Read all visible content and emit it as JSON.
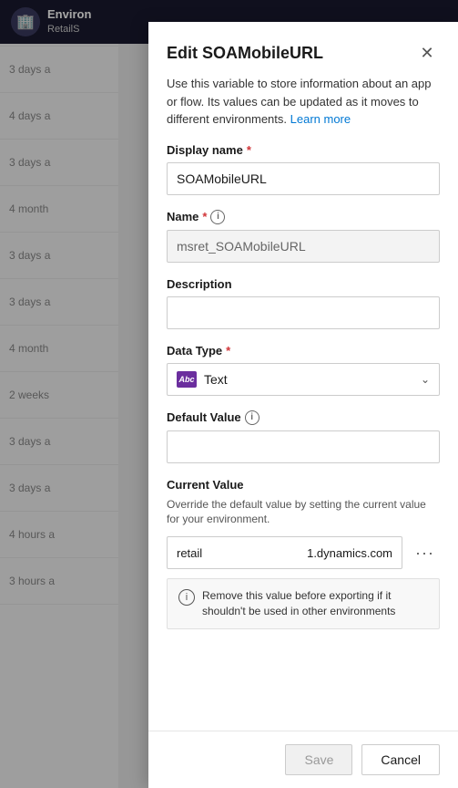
{
  "header": {
    "icon": "🏢",
    "title": "Environ",
    "subtitle": "RetailS"
  },
  "background_items": [
    {
      "time": "3 days a"
    },
    {
      "time": "3 days a"
    },
    {
      "time": "4 days a"
    },
    {
      "time": "3 days a"
    },
    {
      "time": "4 month"
    },
    {
      "time": "3 days a"
    },
    {
      "time": "3 days a"
    },
    {
      "time": "4 month"
    },
    {
      "time": "2 weeks"
    },
    {
      "time": "3 days a"
    },
    {
      "time": "3 days a"
    },
    {
      "time": "4 hours a"
    },
    {
      "time": "3 hours a"
    }
  ],
  "dialog": {
    "title": "Edit SOAMobileURL",
    "description": "Use this variable to store information about an app or flow. Its values can be updated as it moves to different environments.",
    "learn_more_label": "Learn more",
    "fields": {
      "display_name": {
        "label": "Display name",
        "required": true,
        "value": "SOAMobileURL",
        "placeholder": ""
      },
      "name": {
        "label": "Name",
        "required": true,
        "info": true,
        "value": "msret_SOAMobileURL",
        "readonly": true
      },
      "description": {
        "label": "Description",
        "required": false,
        "value": "",
        "placeholder": ""
      },
      "data_type": {
        "label": "Data Type",
        "required": true,
        "type_icon_label": "Abc",
        "selected_value": "Text"
      },
      "default_value": {
        "label": "Default Value",
        "info": true,
        "value": "",
        "placeholder": ""
      },
      "current_value": {
        "label": "Current Value",
        "description": "Override the default value by setting the current value for your environment.",
        "left_text": "retail",
        "right_text": "1.dynamics.com"
      }
    },
    "notice_text": "Remove this value before exporting if it shouldn't be used in other environments",
    "buttons": {
      "save_label": "Save",
      "cancel_label": "Cancel"
    }
  }
}
